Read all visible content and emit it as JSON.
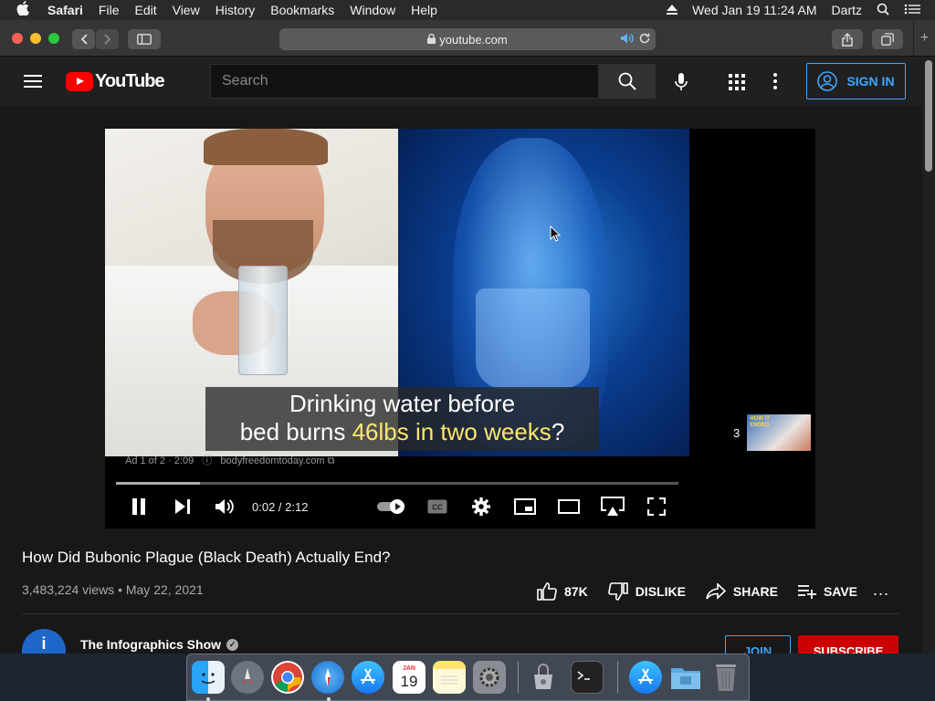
{
  "menubar": {
    "app": "Safari",
    "menus": [
      "File",
      "Edit",
      "View",
      "History",
      "Bookmarks",
      "Window",
      "Help"
    ],
    "datetime": "Wed Jan 19  11:24 AM",
    "user": "Dartz"
  },
  "browser": {
    "url": "youtube.com"
  },
  "youtube": {
    "logo_text": "YouTube",
    "search_placeholder": "Search",
    "sign_in_label": "SIGN IN"
  },
  "player": {
    "caption_line1": "Drinking water before",
    "caption_line2_prefix": "bed burns ",
    "caption_line2_highlight": "46lbs in two weeks",
    "caption_line2_suffix": "?",
    "ad_info": "Ad 1 of 2 · 2:09",
    "ad_domain": "bodyfreedomtoday.com",
    "time": "0:02 / 2:12",
    "progress_fraction": 0.12,
    "endcard_count": "3",
    "endcard_text": "HOW IT ENDED"
  },
  "video": {
    "title": "How Did Bubonic Plague (Black Death) Actually End?",
    "views_date": "3,483,224 views • May 22, 2021",
    "likes": "87K",
    "dislike_label": "DISLIKE",
    "share_label": "SHARE",
    "save_label": "SAVE",
    "more": "..."
  },
  "channel": {
    "name": "The Infographics Show",
    "join_label": "JOIN",
    "subscribe_label": "SUBSCRIBE"
  },
  "dock": {
    "calendar_month": "JAN",
    "calendar_day": "19"
  },
  "colors": {
    "brand_red": "#ff0000",
    "accent_blue": "#3ea6ff",
    "subscribe_red": "#cc0000"
  }
}
